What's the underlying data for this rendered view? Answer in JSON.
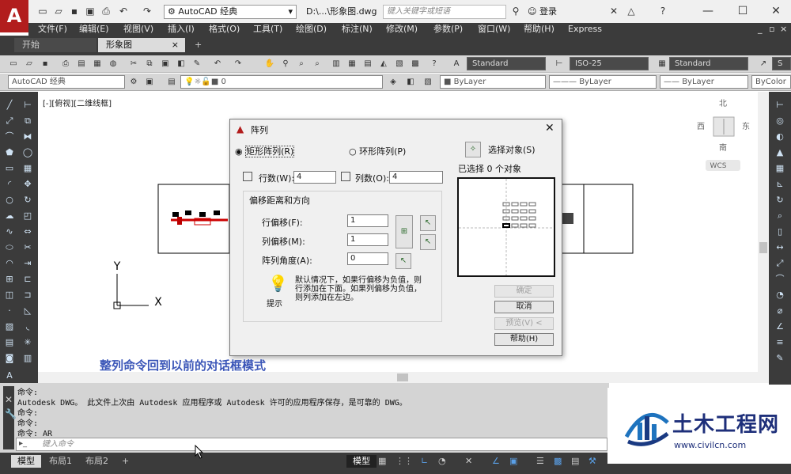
{
  "app": {
    "logo_letter": "A",
    "workspace": "AutoCAD 经典",
    "doc_title": "D:\\...\\形象图.dwg",
    "search_placeholder": "键入关键字或短语",
    "login": "登录",
    "icons": [
      "new-icon",
      "open-icon",
      "save-icon",
      "saveas-icon",
      "print-icon",
      "undo-icon",
      "redo-icon",
      "gear-icon",
      "binoculars-icon",
      "user-icon",
      "close-icon",
      "help-icon",
      "minimize-icon",
      "maximize-icon"
    ]
  },
  "menu": [
    "文件(F)",
    "编辑(E)",
    "视图(V)",
    "插入(I)",
    "格式(O)",
    "工具(T)",
    "绘图(D)",
    "标注(N)",
    "修改(M)",
    "参数(P)",
    "窗口(W)",
    "帮助(H)",
    "Express"
  ],
  "tabs": [
    "开始",
    "形象图"
  ],
  "toolbar": {
    "text_style": "Standard",
    "dim_style": "ISO-25",
    "table_style": "Standard",
    "workspace2": "AutoCAD 经典",
    "layer": "0",
    "color": "ByLayer",
    "linetype": "ByLayer",
    "lineweight": "ByLayer",
    "plotstyle": "ByColor"
  },
  "viewport": {
    "label": "[-][俯视][二维线框]",
    "compass": {
      "n": "北",
      "s": "南",
      "w": "西",
      "e": "东"
    },
    "wcs": "WCS",
    "axis_x": "X",
    "axis_y": "Y"
  },
  "dialog": {
    "title": "阵列",
    "rect_array": "矩形阵列(R)",
    "polar_array": "环形阵列(P)",
    "select_objects": "选择对象(S)",
    "selected": "已选择 0 个对象",
    "rows_label": "行数(W):",
    "rows_value": "4",
    "cols_label": "列数(O):",
    "cols_value": "4",
    "offset_group": "偏移距离和方向",
    "row_offset_label": "行偏移(F):",
    "row_offset": "1",
    "col_offset_label": "列偏移(M):",
    "col_offset": "1",
    "angle_label": "阵列角度(A):",
    "angle": "0",
    "hint_line1": "默认情况下，如果行偏移为负值，则",
    "hint_line2": "行添加在下面。如果列偏移为负值，",
    "hint_line3": "则列添加在左边。",
    "hint_label": "提示",
    "ok": "确定",
    "cancel": "取消",
    "preview": "预览(V) <",
    "help": "帮助(H)"
  },
  "caption": "整列命令回到以前的对话框模式",
  "command": {
    "lines": [
      "命令:",
      "Autodesk DWG。 此文件上次由 Autodesk 应用程序或 Autodesk 许可的应用程序保存，是可靠的 DWG。",
      "命令:",
      "命令:",
      "命令: AR"
    ],
    "placeholder": "键入命令"
  },
  "status": {
    "tabs": [
      "模型",
      "布局1",
      "布局2"
    ],
    "mode": "模型"
  },
  "watermark": {
    "cn": "土木工程网",
    "url": "www.civilcn.com"
  }
}
